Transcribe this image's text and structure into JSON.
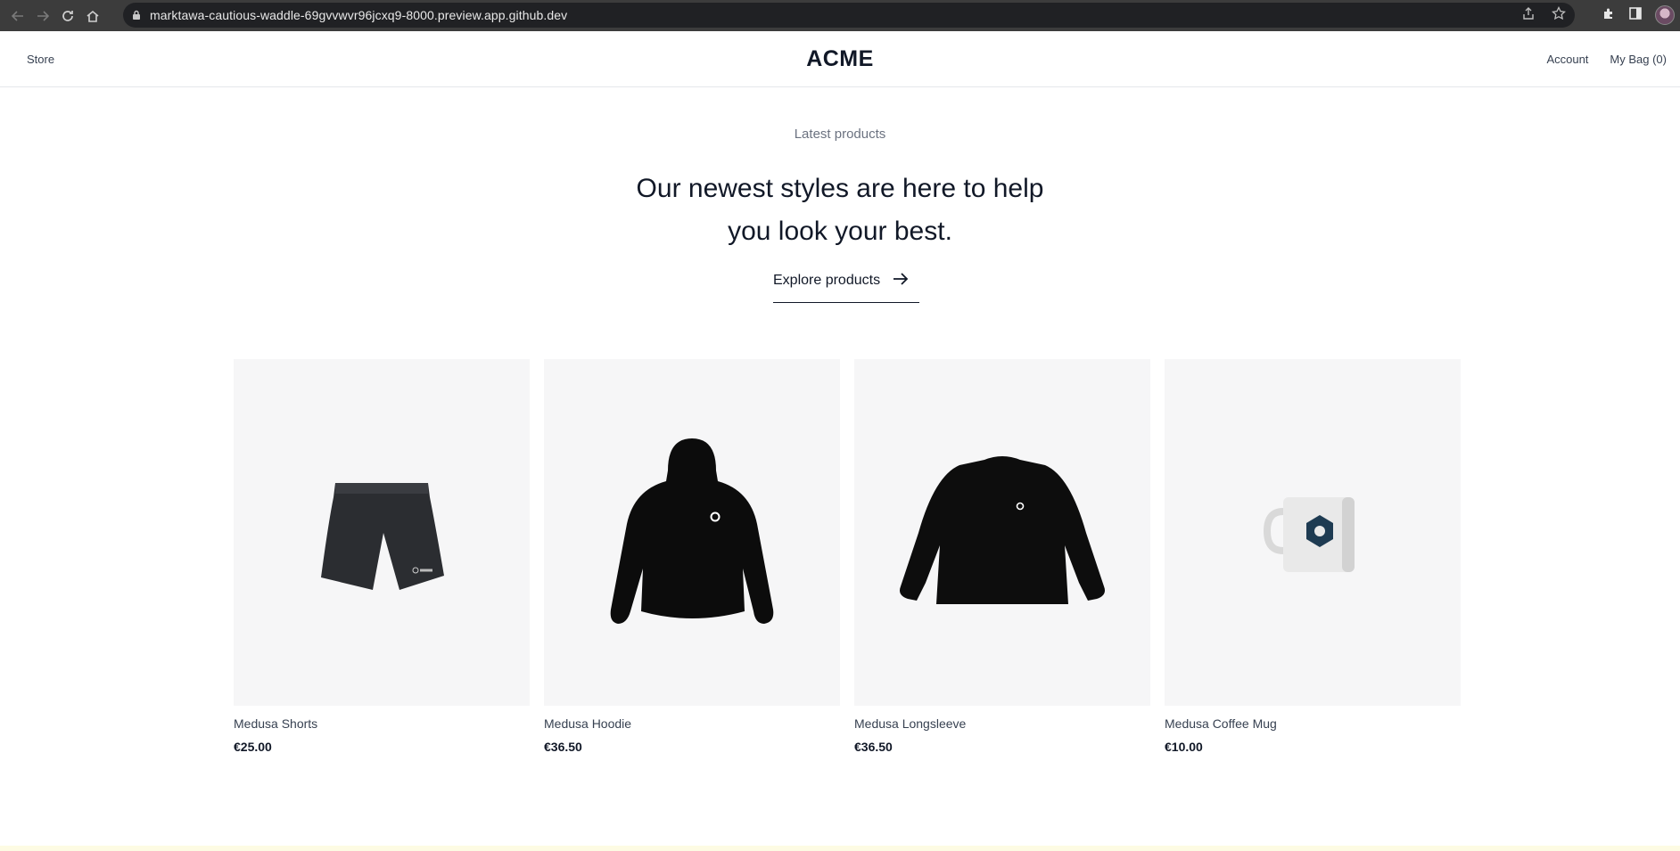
{
  "browser": {
    "url": "marktawa-cautious-waddle-69gvvwvr96jcxq9-8000.preview.app.github.dev",
    "icons": [
      "back-arrow-icon",
      "forward-arrow-icon",
      "reload-icon",
      "home-icon",
      "lock-icon",
      "share-icon",
      "star-icon",
      "extensions-icon",
      "sidepanel-icon",
      "profile-avatar"
    ]
  },
  "header": {
    "store_label": "Store",
    "brand": "ACME",
    "account_label": "Account",
    "bag_label": "My Bag (0)"
  },
  "hero": {
    "kicker": "Latest products",
    "title_line1": "Our newest styles are here to help",
    "title_line2": "you look your best.",
    "cta_label": "Explore products"
  },
  "products": [
    {
      "name": "Medusa Shorts",
      "price": "€25.00",
      "image": "shorts"
    },
    {
      "name": "Medusa Hoodie",
      "price": "€36.50",
      "image": "hoodie"
    },
    {
      "name": "Medusa Longsleeve",
      "price": "€36.50",
      "image": "longsleeve"
    },
    {
      "name": "Medusa Coffee Mug",
      "price": "€10.00",
      "image": "mug"
    }
  ],
  "colors": {
    "accent_text": "#111827",
    "muted_text": "#6b7280",
    "card_bg": "#f6f6f7",
    "footer_strip": "#fdfbe3"
  }
}
